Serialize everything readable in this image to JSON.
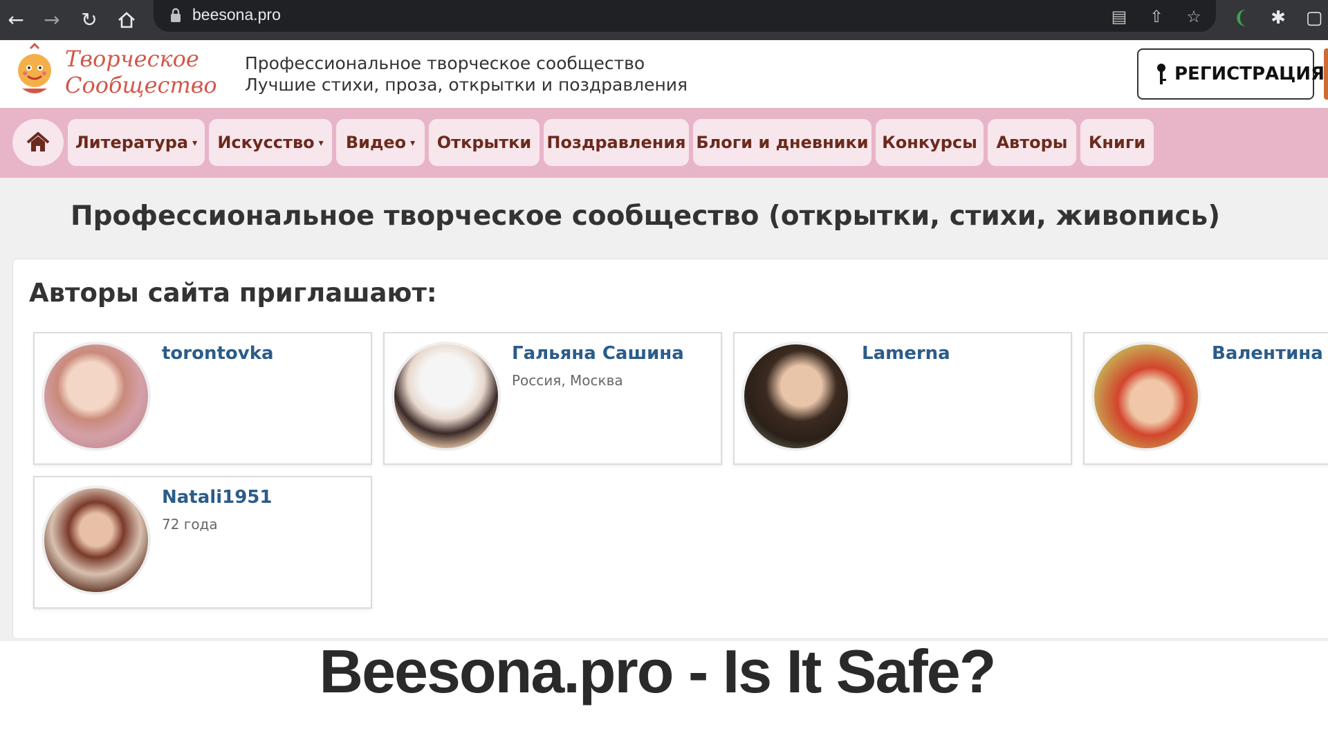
{
  "browser": {
    "url": "beesona.pro",
    "icons": [
      "back-icon",
      "forward-icon",
      "reload-icon",
      "home-icon",
      "lock-icon",
      "translate-icon",
      "share-icon",
      "star-icon",
      "extension-leaf-icon",
      "puzzle-icon",
      "window-icon"
    ]
  },
  "header": {
    "logo_line1": "Творческое",
    "logo_line2": "Сообщество",
    "tagline_1": "Профессиональное творческое сообщество",
    "tagline_2": "Лучшие стихи, проза, открытки и поздравления",
    "register_label": "РЕГИСТРАЦИЯ"
  },
  "nav": {
    "items": [
      {
        "label": "Литература",
        "dropdown": true
      },
      {
        "label": "Искусство",
        "dropdown": true
      },
      {
        "label": "Видео",
        "dropdown": true
      },
      {
        "label": "Открытки",
        "dropdown": false
      },
      {
        "label": "Поздравления",
        "dropdown": false
      },
      {
        "label": "Блоги и дневники",
        "dropdown": false
      },
      {
        "label": "Конкурсы",
        "dropdown": false
      },
      {
        "label": "Авторы",
        "dropdown": false
      },
      {
        "label": "Книги",
        "dropdown": false
      }
    ]
  },
  "main": {
    "title": "Профессиональное творческое сообщество (открытки, стихи, живопись)",
    "section_title": "Авторы сайта приглашают:",
    "authors": [
      {
        "name": "torontovka",
        "meta": ""
      },
      {
        "name": "Гальяна Сашина",
        "meta": "Россия, Москва"
      },
      {
        "name": "Lamerna",
        "meta": ""
      },
      {
        "name": "Валентина За",
        "meta": ""
      },
      {
        "name": "Natali1951",
        "meta": "72 года"
      }
    ]
  },
  "banner": {
    "text": "Beesona.pro - Is It Safe?"
  },
  "colors": {
    "nav_bg": "#e8b4c8",
    "nav_item_bg": "#f7e6ec",
    "nav_text": "#6b2a1c",
    "author_link": "#2b5c8a",
    "logo": "#d4564a"
  }
}
